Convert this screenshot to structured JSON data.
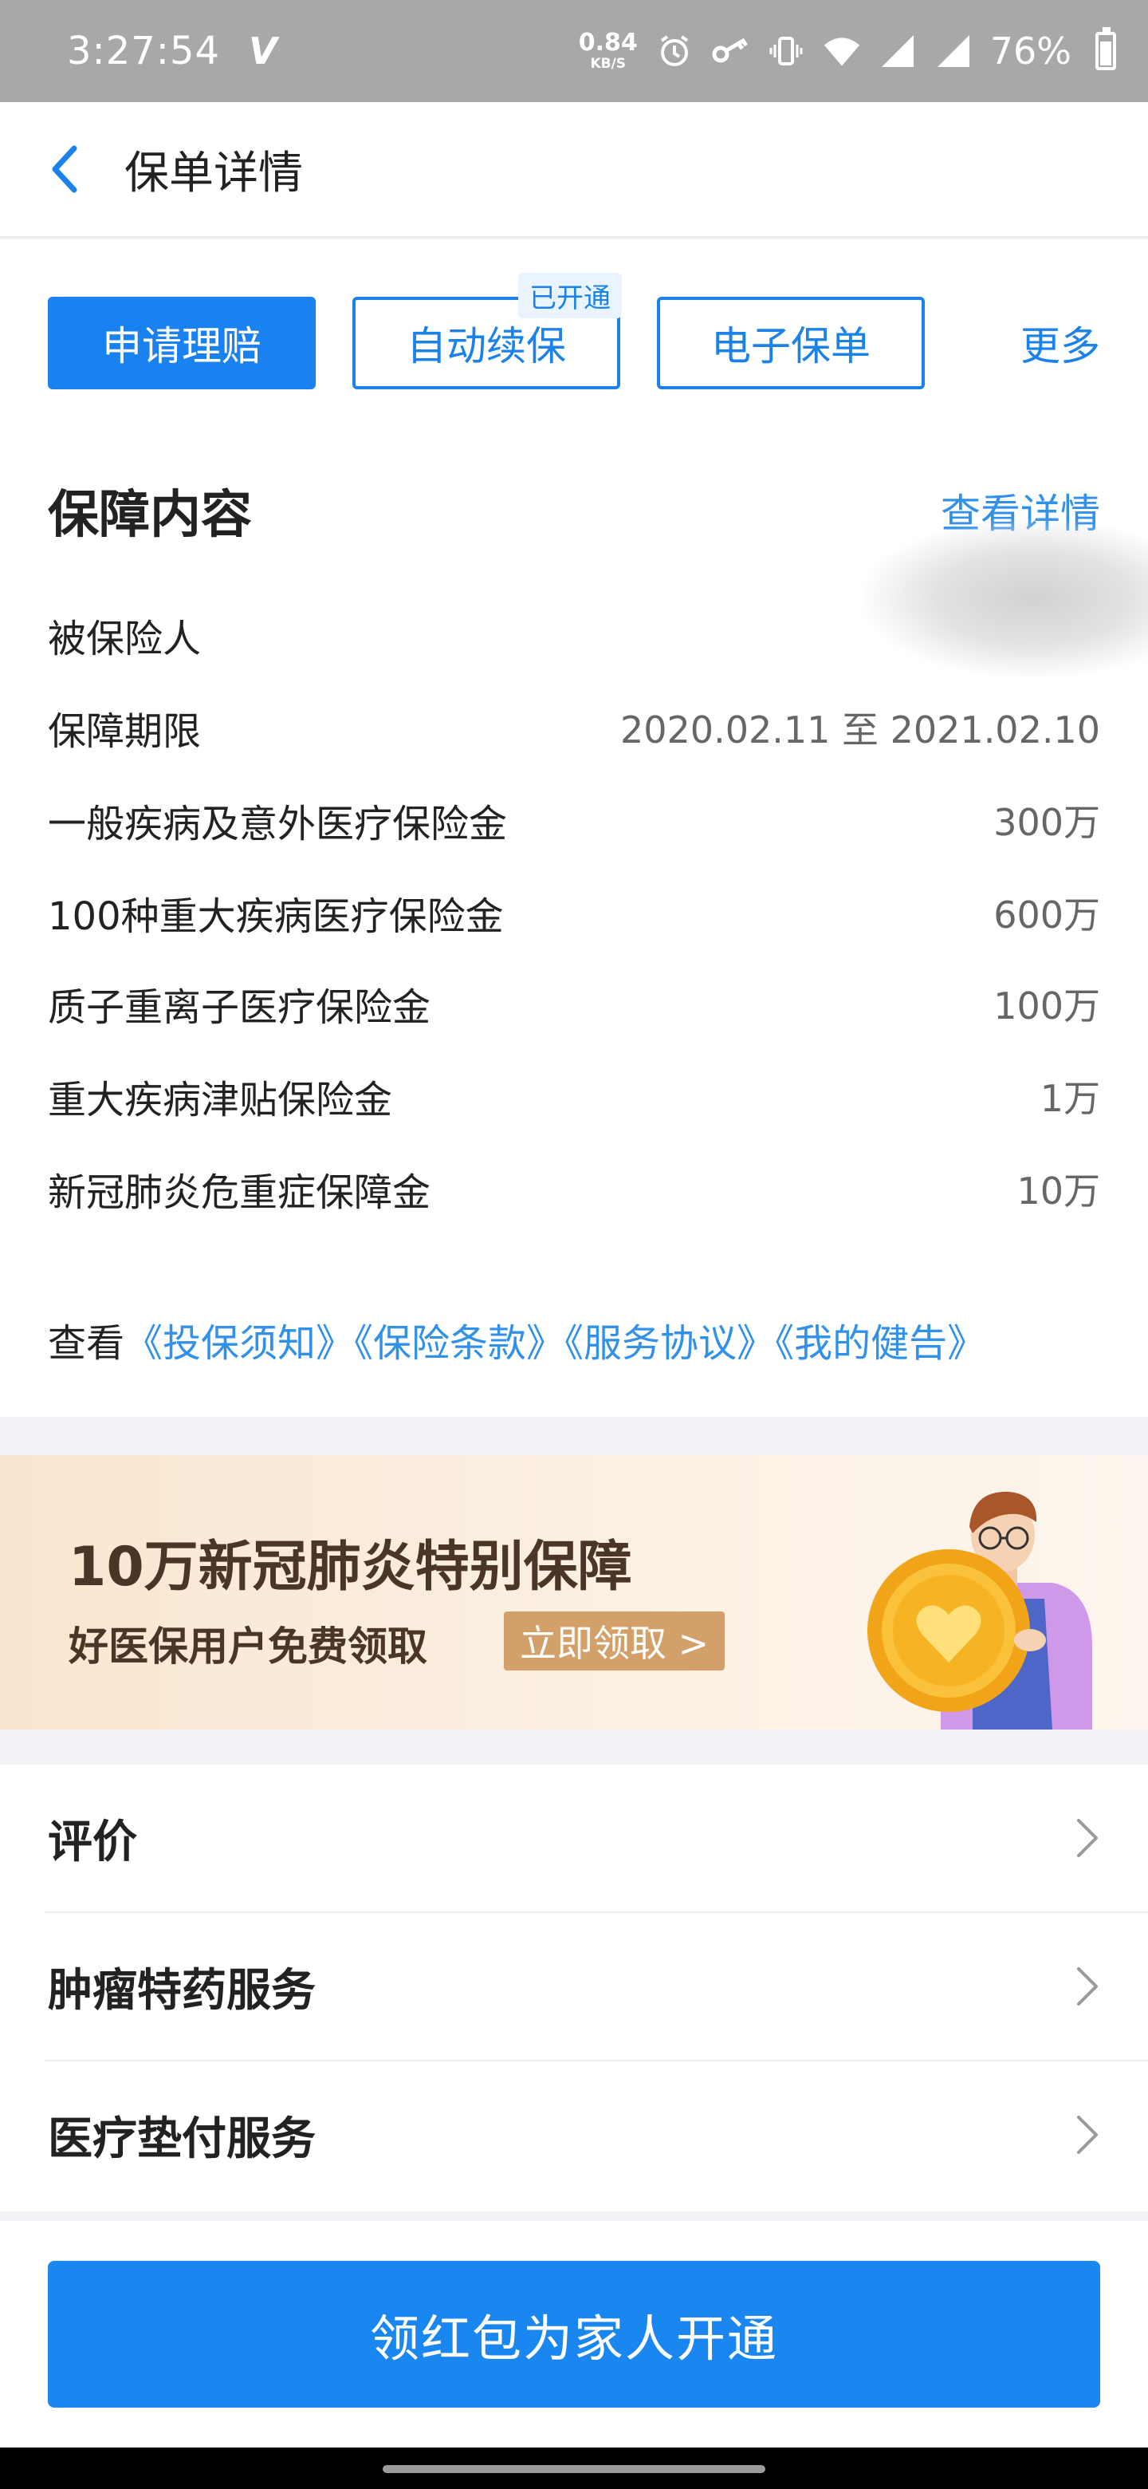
{
  "status_bar": {
    "time": "3:27:54",
    "carrier_mark": "V",
    "net_speed_value": "0.84",
    "net_speed_unit": "KB/S",
    "battery": "76%",
    "icons": [
      "alarm-icon",
      "key-icon",
      "vibrate-icon",
      "wifi-icon",
      "signal-icon",
      "signal-icon",
      "battery-icon"
    ]
  },
  "header": {
    "title": "保单详情",
    "back_icon": "chevron-left-icon"
  },
  "actions": {
    "claim_label": "申请理赔",
    "auto_renew_label": "自动续保",
    "auto_renew_badge": "已开通",
    "e_policy_label": "电子保单",
    "more_label": "更多"
  },
  "coverage": {
    "title": "保障内容",
    "view_detail": "查看详情",
    "rows": [
      {
        "label": "被保险人",
        "value": ""
      },
      {
        "label": "保障期限",
        "value": "2020.02.11 至 2021.02.10"
      },
      {
        "label": "一般疾病及意外医疗保险金",
        "value": "300万"
      },
      {
        "label": "100种重大疾病医疗保险金",
        "value": "600万"
      },
      {
        "label": "质子重离子医疗保险金",
        "value": "100万"
      },
      {
        "label": "重大疾病津贴保险金",
        "value": "1万"
      },
      {
        "label": "新冠肺炎危重症保障金",
        "value": "10万"
      }
    ]
  },
  "documents": {
    "prefix": "查看",
    "links": [
      "《投保须知》",
      "《保险条款》",
      "《服务协议》",
      "《我的健告》"
    ]
  },
  "banner": {
    "title": "10万新冠肺炎特别保障",
    "subtitle": "好医保用户免费领取",
    "cta": "立即领取 >"
  },
  "services": {
    "items": [
      "评价",
      "肿瘤特药服务",
      "医疗垫付服务"
    ]
  },
  "bottom": {
    "cta": "领红包为家人开通"
  },
  "colors": {
    "accent": "#1a82f0",
    "link": "#3190e8",
    "banner_text": "#4a3526",
    "banner_cta": "#d4a06a"
  }
}
